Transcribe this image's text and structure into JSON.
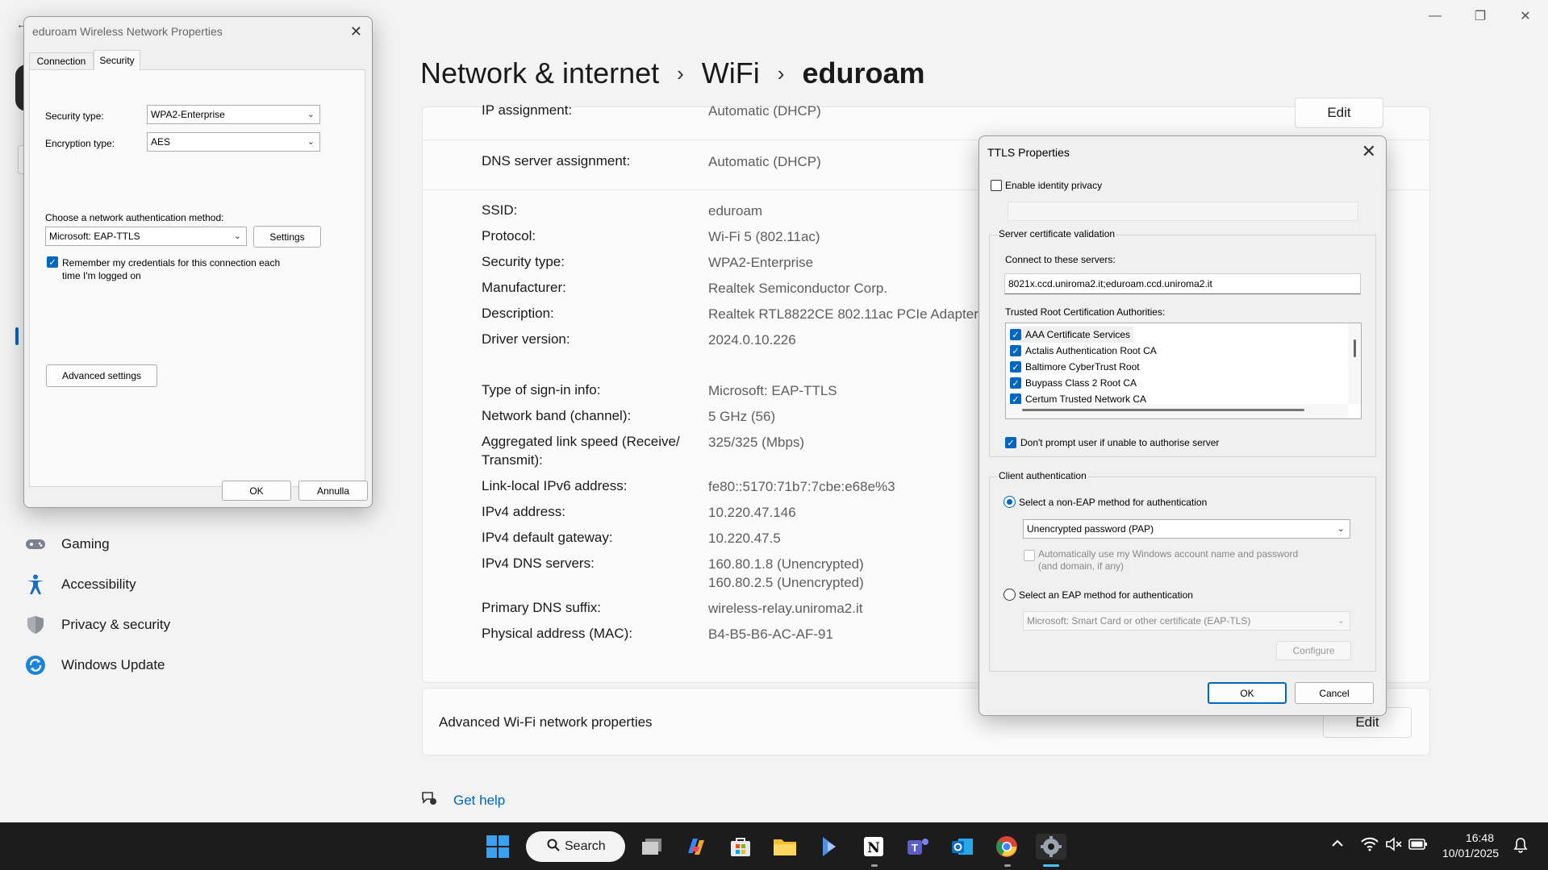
{
  "window_controls": {
    "minimize": "—",
    "maximize": "❐",
    "close": "✕"
  },
  "breadcrumb": {
    "level1": "Network & internet",
    "level2": "WiFi",
    "current": "eduroam",
    "separator": "›"
  },
  "sidebar": {
    "items": [
      {
        "label": "Gaming",
        "icon": "gamepad-icon"
      },
      {
        "label": "Accessibility",
        "icon": "accessibility-icon"
      },
      {
        "label": "Privacy & security",
        "icon": "shield-icon"
      },
      {
        "label": "Windows Update",
        "icon": "update-icon"
      }
    ]
  },
  "properties": {
    "edit_label": "Edit",
    "rows": [
      {
        "label": "IP assignment:",
        "value": "Automatic (DHCP)"
      },
      {
        "label": "DNS server assignment:",
        "value": "Automatic (DHCP)"
      },
      {
        "label": "SSID:",
        "value": "eduroam"
      },
      {
        "label": "Protocol:",
        "value": "Wi-Fi 5 (802.11ac)"
      },
      {
        "label": "Security type:",
        "value": "WPA2-Enterprise"
      },
      {
        "label": "Manufacturer:",
        "value": "Realtek Semiconductor Corp."
      },
      {
        "label": "Description:",
        "value": "Realtek RTL8822CE 802.11ac PCIe Adapter"
      },
      {
        "label": "Driver version:",
        "value": "2024.0.10.226"
      },
      {
        "label": "Type of sign-in info:",
        "value": "Microsoft: EAP-TTLS"
      },
      {
        "label": "Network band (channel):",
        "value": "5 GHz (56)"
      },
      {
        "label": "Aggregated link speed (Receive/",
        "label2": "Transmit):",
        "value": "325/325 (Mbps)"
      },
      {
        "label": "Link-local IPv6 address:",
        "value": "fe80::5170:71b7:7cbe:e68e%3"
      },
      {
        "label": "IPv4 address:",
        "value": "10.220.47.146"
      },
      {
        "label": "IPv4 default gateway:",
        "value": "10.220.47.5"
      },
      {
        "label": "IPv4 DNS servers:",
        "value": "160.80.1.8 (Unencrypted)",
        "value2": "160.80.2.5 (Unencrypted)"
      },
      {
        "label": "Primary DNS suffix:",
        "value": "wireless-relay.uniroma2.it"
      },
      {
        "label": "Physical address (MAC):",
        "value": "B4-B5-B6-AC-AF-91"
      }
    ]
  },
  "advanced": {
    "label": "Advanced Wi-Fi network properties",
    "edit_label": "Edit"
  },
  "get_help": "Get help",
  "wireless_dialog": {
    "title": "eduroam Wireless Network Properties",
    "tabs": [
      "Connection",
      "Security"
    ],
    "active_tab": "Security",
    "security_type_label": "Security type:",
    "security_type_value": "WPA2-Enterprise",
    "encryption_type_label": "Encryption type:",
    "encryption_type_value": "AES",
    "auth_method_label": "Choose a network authentication method:",
    "auth_method_value": "Microsoft: EAP-TTLS",
    "settings_button": "Settings",
    "remember_label_1": "Remember my credentials for this connection each",
    "remember_label_2": "time I'm logged on",
    "remember_checked": true,
    "advanced_button": "Advanced settings",
    "ok": "OK",
    "cancel": "Annulla"
  },
  "ttls_dialog": {
    "title": "TTLS Properties",
    "identity_privacy_label": "Enable identity privacy",
    "identity_privacy_checked": false,
    "server_validation_group": "Server certificate validation",
    "connect_servers_label": "Connect to these servers:",
    "connect_servers_value": "8021x.ccd.uniroma2.it;eduroam.ccd.uniroma2.it",
    "trusted_root_label": "Trusted Root Certification Authorities:",
    "cas": [
      {
        "name": "AAA Certificate Services",
        "checked": true
      },
      {
        "name": "Actalis Authentication Root CA",
        "checked": true
      },
      {
        "name": "Baltimore CyberTrust Root",
        "checked": true
      },
      {
        "name": "Buypass Class 2 Root CA",
        "checked": true
      },
      {
        "name": "Certum Trusted Network CA",
        "checked": true
      }
    ],
    "dont_prompt_label": "Don't prompt user if unable to authorise server",
    "dont_prompt_checked": true,
    "client_auth_group": "Client authentication",
    "non_eap_label": "Select a non-EAP method for authentication",
    "non_eap_value": "Unencrypted password (PAP)",
    "auto_windows_label_1": "Automatically use my Windows account name and password",
    "auto_windows_label_2": "(and domain, if any)",
    "eap_label": "Select an EAP method for authentication",
    "eap_value": "Microsoft: Smart Card or other certificate (EAP-TLS)",
    "configure_button": "Configure",
    "ok": "OK",
    "cancel": "Cancel"
  },
  "taskbar": {
    "search_label": "Search",
    "time": "16:48",
    "date": "10/01/2025",
    "accent": "#0067c0"
  }
}
